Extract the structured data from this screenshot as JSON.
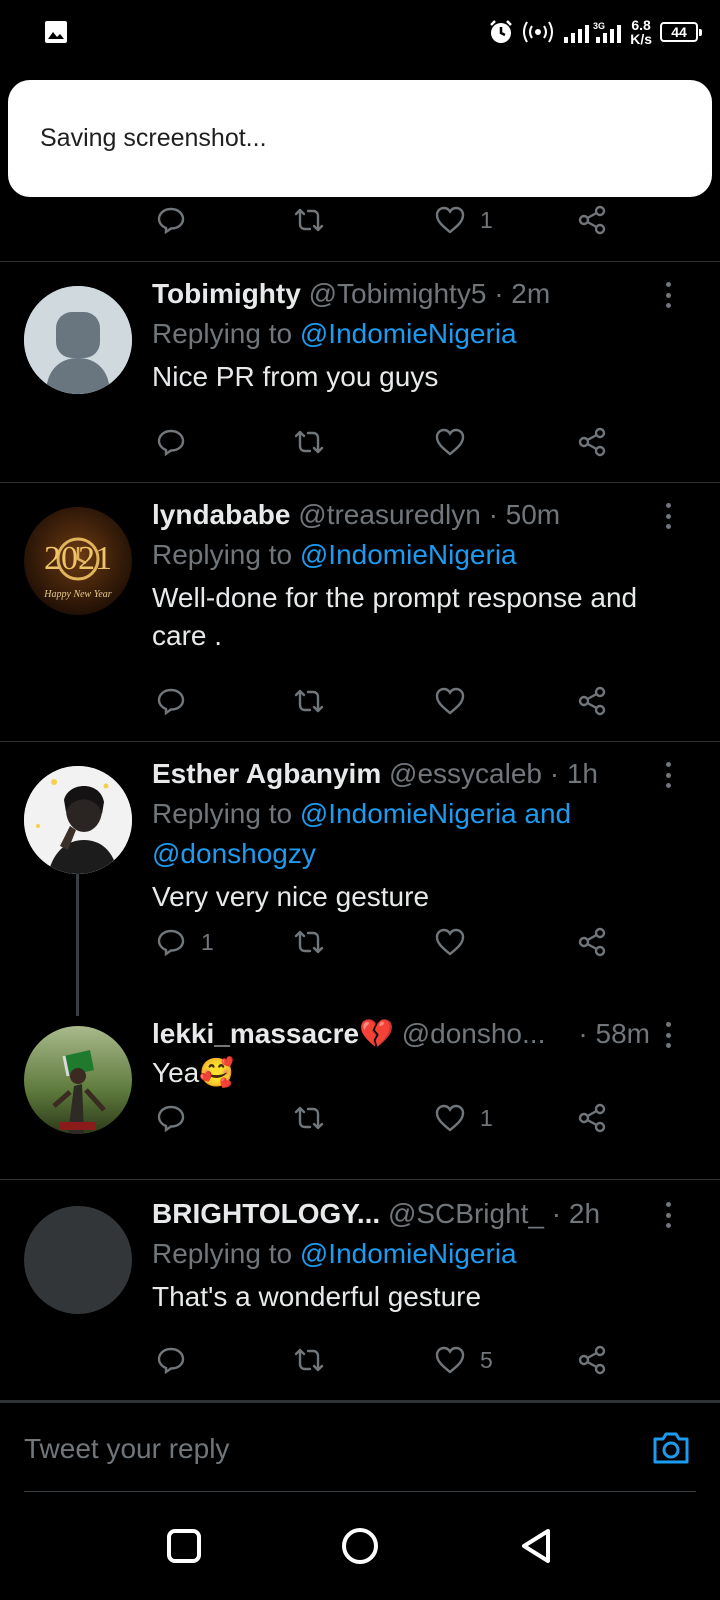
{
  "status_bar": {
    "speed_value": "6.8",
    "speed_unit": "K/s",
    "battery": "44",
    "net_label": "3G"
  },
  "toast": {
    "text": "Saving screenshot..."
  },
  "top_tweet": {
    "like_count": "1"
  },
  "tweets": [
    {
      "name": "Tobimighty",
      "handle": "@Tobimighty5",
      "time": "· 2m",
      "replying_prefix": "Replying to",
      "replying_to": "@IndomieNigeria",
      "text": "Nice PR from you guys",
      "reply_count": "",
      "like_count": ""
    },
    {
      "name": "lyndababe",
      "handle": "@treasuredlyn",
      "time": "· 50m",
      "replying_prefix": "Replying to",
      "replying_to": "@IndomieNigeria",
      "text": "Well-done for the prompt response and care .",
      "avatar_text_top": "2021",
      "avatar_text_bottom": "Happy New Year",
      "reply_count": "",
      "like_count": ""
    },
    {
      "name": "Esther Agbanyim",
      "handle": "@essycaleb",
      "time": "· 1h",
      "replying_prefix": "Replying to",
      "replying_to": "@IndomieNigeria and @donshogzy",
      "text": "Very very nice gesture",
      "reply_count": "1",
      "like_count": ""
    },
    {
      "name": "lekki_massacre💔",
      "handle": "@donsho...",
      "time": "· 58m",
      "text": "Yea🥰",
      "reply_count": "",
      "like_count": "1"
    },
    {
      "name": "BRIGHTOLOGY...",
      "handle": "@SCBright_",
      "time": "· 2h",
      "replying_prefix": "Replying to",
      "replying_to": "@IndomieNigeria",
      "text": "That's  a wonderful gesture",
      "reply_count": "",
      "like_count": "5"
    }
  ],
  "reply_bar": {
    "placeholder": "Tweet your reply"
  },
  "colors": {
    "background": "#000000",
    "link": "#1d9bf0",
    "muted": "#71767b",
    "divider": "#2f3336",
    "text": "#e7e9ea"
  },
  "icons": [
    "gallery-icon",
    "alarm-icon",
    "hotspot-icon",
    "signal-icon",
    "battery-icon",
    "reply-icon",
    "retweet-icon",
    "like-icon",
    "share-icon",
    "more-icon",
    "camera-icon",
    "recents-nav-icon",
    "home-nav-icon",
    "back-nav-icon"
  ]
}
